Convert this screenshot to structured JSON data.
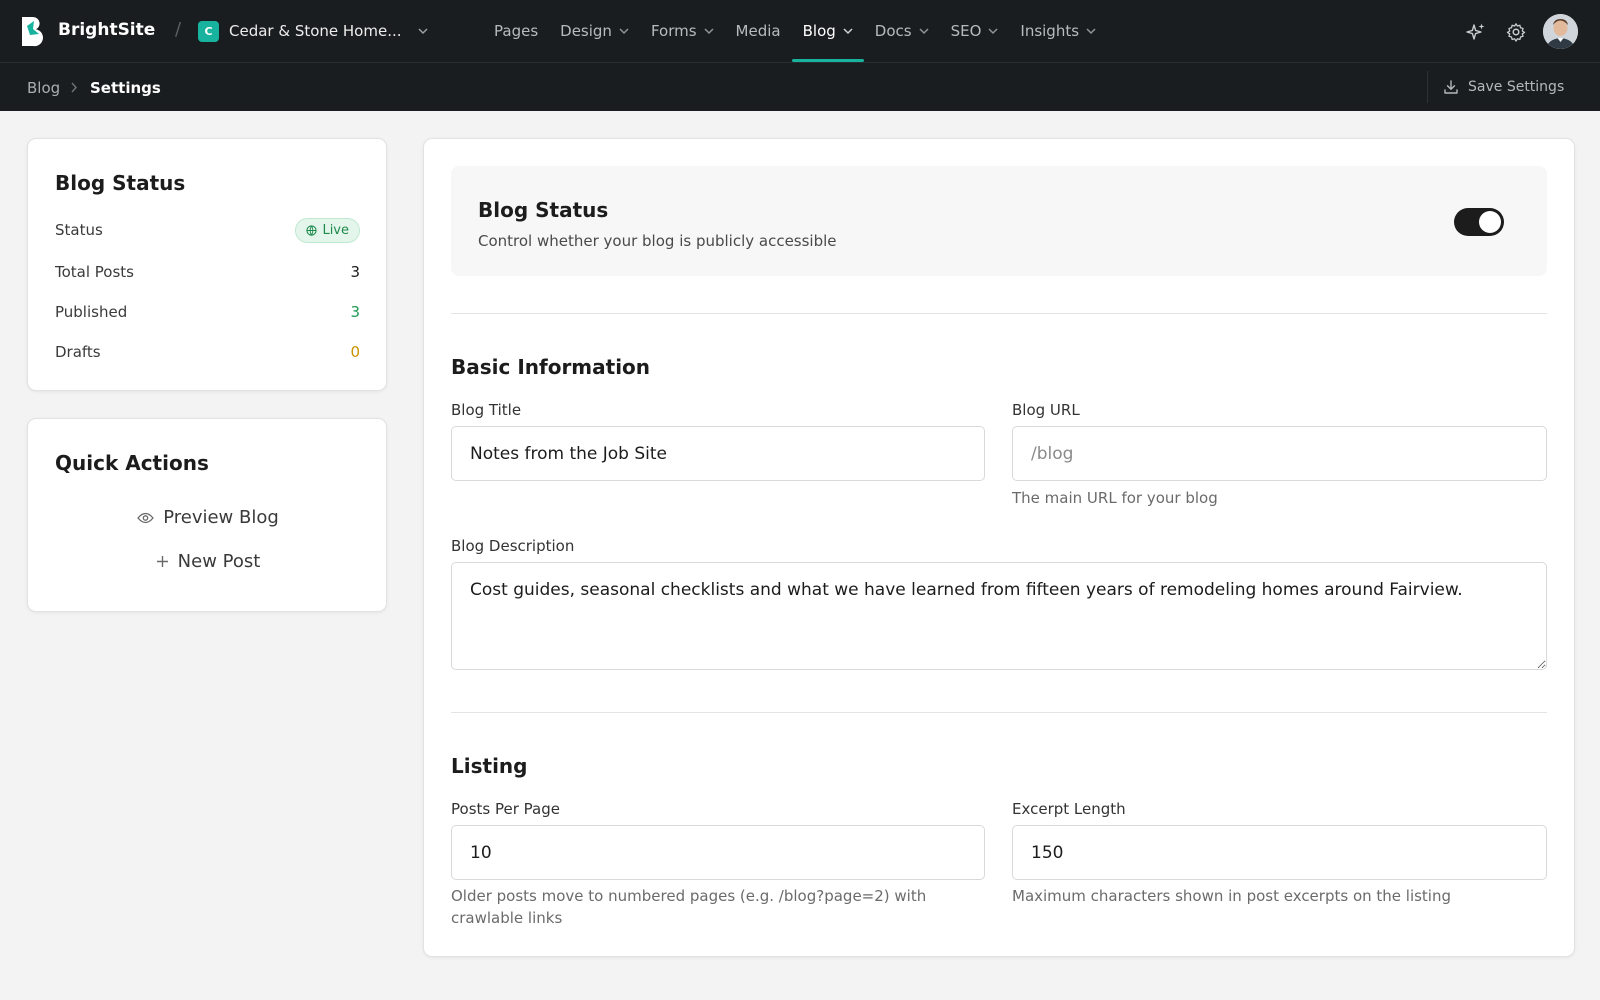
{
  "brand": {
    "name": "BrightSite",
    "accent": "#17b39e"
  },
  "site": {
    "initial": "C",
    "name": "Cedar & Stone Home..."
  },
  "nav": [
    {
      "label": "Pages",
      "dropdown": false,
      "active": false
    },
    {
      "label": "Design",
      "dropdown": true,
      "active": false
    },
    {
      "label": "Forms",
      "dropdown": true,
      "active": false
    },
    {
      "label": "Media",
      "dropdown": false,
      "active": false
    },
    {
      "label": "Blog",
      "dropdown": true,
      "active": true
    },
    {
      "label": "Docs",
      "dropdown": true,
      "active": false
    },
    {
      "label": "SEO",
      "dropdown": true,
      "active": false
    },
    {
      "label": "Insights",
      "dropdown": true,
      "active": false
    }
  ],
  "breadcrumb": {
    "parent": "Blog",
    "current": "Settings"
  },
  "toolbar": {
    "save_label": "Save Settings"
  },
  "status_card": {
    "title": "Blog Status",
    "status_label": "Status",
    "status_value": "Live",
    "total_label": "Total Posts",
    "total_value": "3",
    "published_label": "Published",
    "published_value": "3",
    "drafts_label": "Drafts",
    "drafts_value": "0"
  },
  "quick_actions": {
    "title": "Quick Actions",
    "preview_label": "Preview Blog",
    "new_post_label": "New Post"
  },
  "settings": {
    "status_title": "Blog Status",
    "status_desc": "Control whether your blog is publicly accessible",
    "basic_title": "Basic Information",
    "blog_title_label": "Blog Title",
    "blog_title_value": "Notes from the Job Site",
    "blog_url_label": "Blog URL",
    "blog_url_placeholder": "/blog",
    "blog_url_help": "The main URL for your blog",
    "desc_label": "Blog Description",
    "desc_value": "Cost guides, seasonal checklists and what we have learned from fifteen years of remodeling homes around Fairview.",
    "listing_title": "Listing",
    "ppp_label": "Posts Per Page",
    "ppp_value": "10",
    "ppp_help": "Older posts move to numbered pages (e.g. /blog?page=2) with crawlable links",
    "excerpt_label": "Excerpt Length",
    "excerpt_value": "150",
    "excerpt_help": "Maximum characters shown in post excerpts on the listing"
  }
}
